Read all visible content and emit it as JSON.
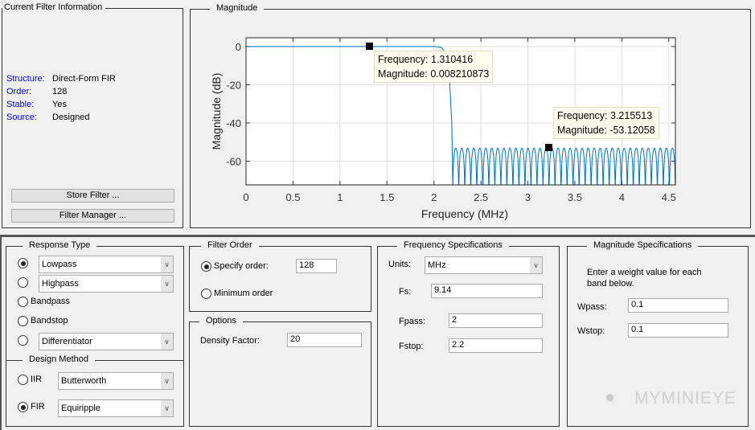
{
  "filter_info": {
    "title": "Current Filter Information",
    "rows": [
      {
        "label": "Structure:",
        "value": "Direct-Form FIR"
      },
      {
        "label": "Order:",
        "value": "128"
      },
      {
        "label": "Stable:",
        "value": "Yes"
      },
      {
        "label": "Source:",
        "value": "Designed"
      }
    ],
    "store_filter": "Store Filter ...",
    "filter_manager": "Filter Manager ..."
  },
  "plot_panel": {
    "title": "Magnitude"
  },
  "chart_data": {
    "type": "line",
    "xlabel": "Frequency (MHz)",
    "ylabel": "Magnitude (dB)",
    "xlim": [
      0,
      4.57
    ],
    "ylim": [
      -72.4,
      4.6
    ],
    "grid": true,
    "xticks": [
      "0",
      "0.5",
      "1",
      "1.5",
      "2",
      "2.5",
      "3",
      "3.5",
      "4",
      "4.5"
    ],
    "yticks": [
      "0",
      "-20",
      "-40",
      "-60"
    ],
    "passband_points": [
      [
        0,
        0
      ],
      [
        2.02,
        0
      ],
      [
        2.08,
        -0.5
      ],
      [
        2.12,
        -3
      ],
      [
        2.16,
        -12
      ],
      [
        2.19,
        -40
      ],
      [
        2.2,
        -72
      ]
    ],
    "stopband": {
      "start": 2.2,
      "end": 4.57,
      "peak_db": -53.12058,
      "lobes": 37
    },
    "color": "#0072bd",
    "datatips": [
      {
        "frequency_label": "Frequency: 1.310416",
        "magnitude_label": "Magnitude: 0.008210873",
        "x": 1.310416,
        "y": 0.008210873
      },
      {
        "frequency_label": "Frequency: 3.215513",
        "magnitude_label": "Magnitude: -53.12058",
        "x": 3.215513,
        "y": -53.12058
      }
    ]
  },
  "response_type": {
    "title": "Response Type",
    "lowpass": "Lowpass",
    "highpass": "Highpass",
    "bandpass": "Bandpass",
    "bandstop": "Bandstop",
    "differentiator": "Differentiator",
    "selected": "Lowpass"
  },
  "design_method": {
    "title": "Design Method",
    "iir": "IIR",
    "iir_value": "Butterworth",
    "fir": "FIR",
    "fir_value": "Equiripple",
    "selected": "FIR"
  },
  "filter_order": {
    "title": "Filter Order",
    "specify": "Specify order:",
    "order_value": "128",
    "minimum": "Minimum order",
    "selected": "Specify order"
  },
  "options": {
    "title": "Options",
    "density_label": "Density Factor:",
    "density_value": "20"
  },
  "freq_specs": {
    "title": "Frequency Specifications",
    "units_label": "Units:",
    "units_value": "MHz",
    "fs_label": "Fs:",
    "fs_value": "9.14",
    "fpass_label": "Fpass:",
    "fpass_value": "2",
    "fstop_label": "Fstop:",
    "fstop_value": "2.2"
  },
  "mag_specs": {
    "title": "Magnitude Specifications",
    "desc1": "Enter a weight value for each",
    "desc2": "band below.",
    "wpass_label": "Wpass:",
    "wpass_value": "0.1",
    "wstop_label": "Wstop:",
    "wstop_value": "0.1"
  },
  "watermark": "MYMINIEYE"
}
